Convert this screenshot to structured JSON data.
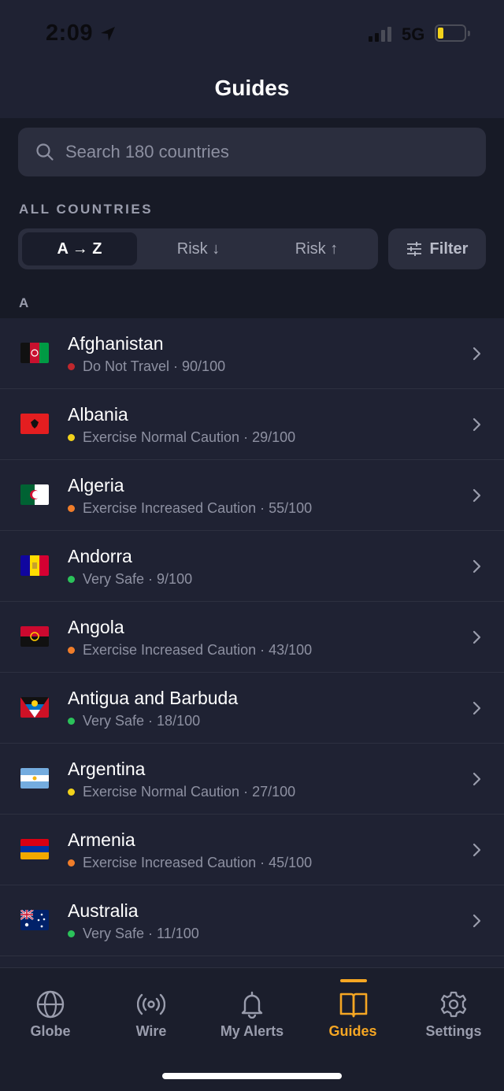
{
  "status_bar": {
    "time": "2:09",
    "network": "5G",
    "battery_level": 0.18
  },
  "header": {
    "title": "Guides"
  },
  "search": {
    "placeholder": "Search 180 countries"
  },
  "section_label": "ALL COUNTRIES",
  "sort": {
    "options": [
      {
        "label": "A → Z",
        "active": true
      },
      {
        "label": "Risk ↓",
        "active": false
      },
      {
        "label": "Risk ↑",
        "active": false
      }
    ],
    "filter_label": "Filter"
  },
  "letter_header": "A",
  "risk_colors": {
    "red": "#c0272d",
    "yellow": "#f2d21b",
    "orange": "#f07d2a",
    "green": "#2bc25a"
  },
  "countries": [
    {
      "name": "Afghanistan",
      "risk": "Do Not Travel · 90/100",
      "level": "red",
      "flag": "afghanistan-flag"
    },
    {
      "name": "Albania",
      "risk": "Exercise Normal Caution · 29/100",
      "level": "yellow",
      "flag": "albania-flag"
    },
    {
      "name": "Algeria",
      "risk": "Exercise Increased Caution · 55/100",
      "level": "orange",
      "flag": "algeria-flag"
    },
    {
      "name": "Andorra",
      "risk": "Very Safe · 9/100",
      "level": "green",
      "flag": "andorra-flag"
    },
    {
      "name": "Angola",
      "risk": "Exercise Increased Caution · 43/100",
      "level": "orange",
      "flag": "angola-flag"
    },
    {
      "name": "Antigua and Barbuda",
      "risk": "Very Safe · 18/100",
      "level": "green",
      "flag": "antigua-flag"
    },
    {
      "name": "Argentina",
      "risk": "Exercise Normal Caution · 27/100",
      "level": "yellow",
      "flag": "argentina-flag"
    },
    {
      "name": "Armenia",
      "risk": "Exercise Increased Caution · 45/100",
      "level": "orange",
      "flag": "armenia-flag"
    },
    {
      "name": "Australia",
      "risk": "Very Safe · 11/100",
      "level": "green",
      "flag": "australia-flag"
    }
  ],
  "tabs": [
    {
      "label": "Globe",
      "icon": "globe-icon",
      "active": false
    },
    {
      "label": "Wire",
      "icon": "broadcast-icon",
      "active": false
    },
    {
      "label": "My Alerts",
      "icon": "bell-icon",
      "active": false
    },
    {
      "label": "Guides",
      "icon": "book-icon",
      "active": true
    },
    {
      "label": "Settings",
      "icon": "gear-icon",
      "active": false
    }
  ]
}
